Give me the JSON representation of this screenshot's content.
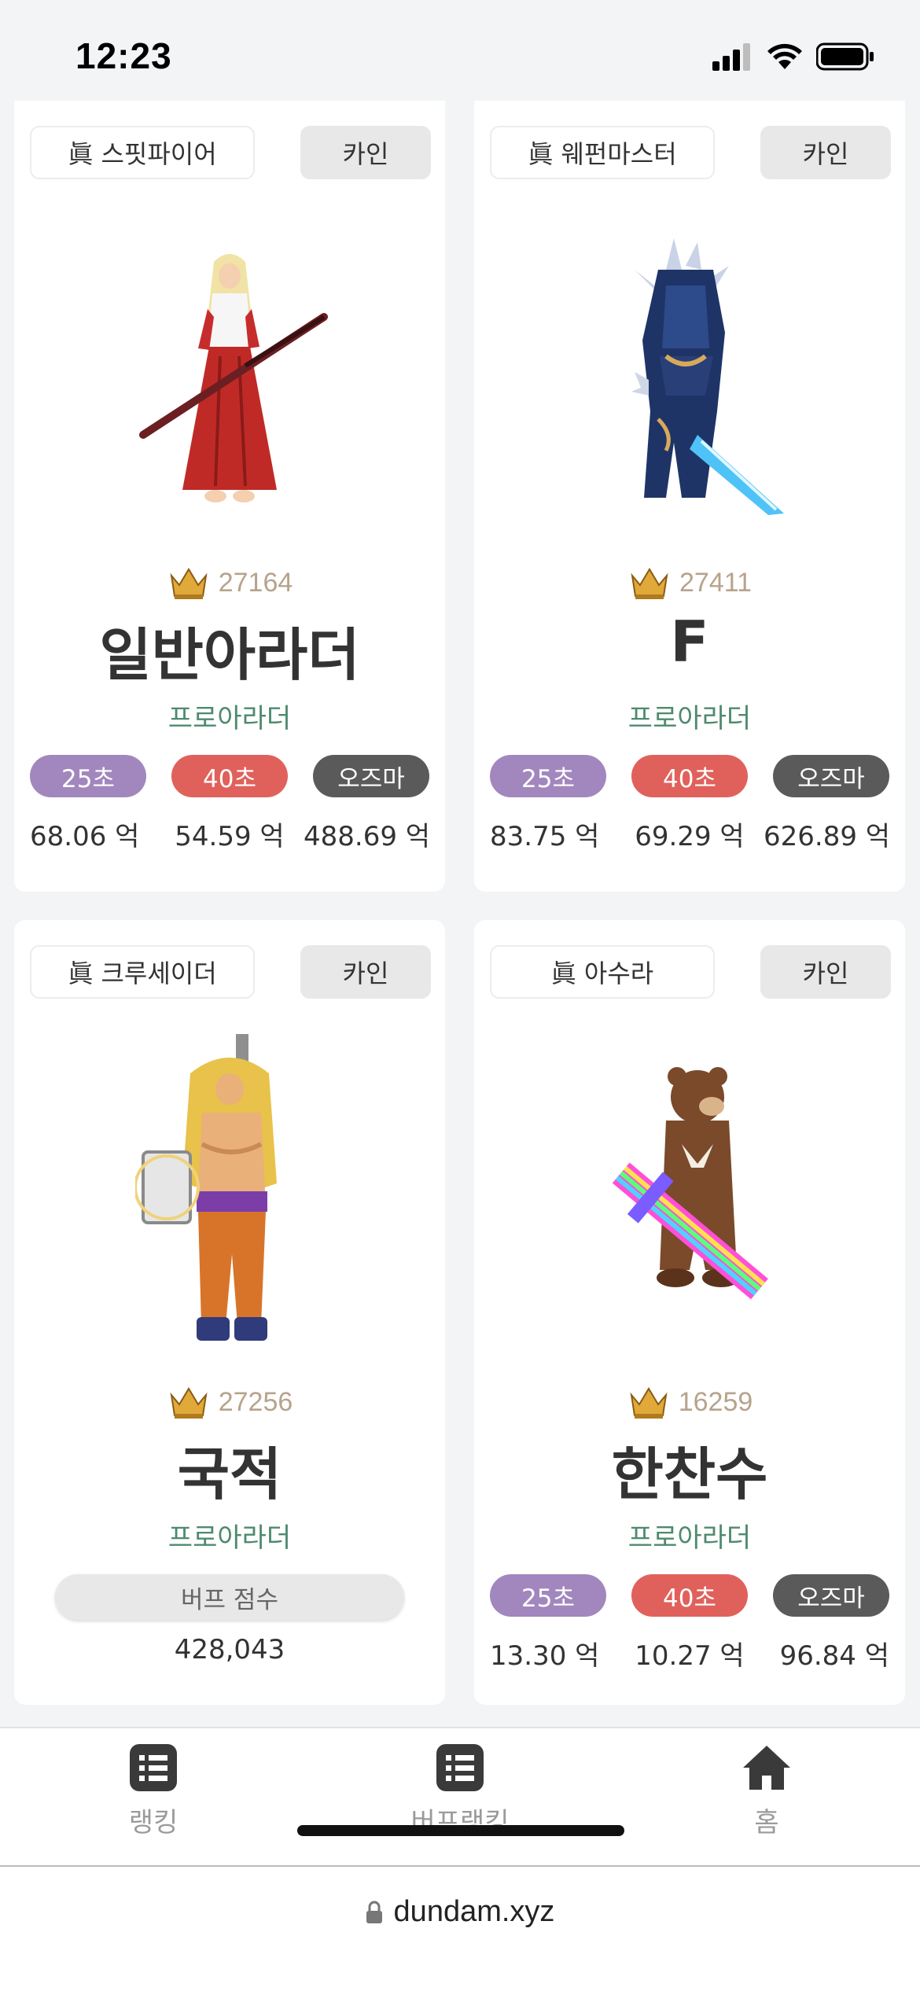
{
  "status_bar": {
    "time": "12:23"
  },
  "cards": [
    {
      "job": "眞 스핏파이어",
      "server": "카인",
      "rank": "27164",
      "name": "일반아라더",
      "adventure": "프로아라더",
      "type": "dealer",
      "labels": [
        "25초",
        "40초",
        "오즈마"
      ],
      "values": [
        "68.06 억",
        "54.59 억",
        "488.69 억"
      ],
      "character_icon": "shrine-maiden-sword-character"
    },
    {
      "job": "眞 웨펀마스터",
      "server": "카인",
      "rank": "27411",
      "name": "F",
      "adventure": "프로아라더",
      "type": "dealer",
      "labels": [
        "25초",
        "40초",
        "오즈마"
      ],
      "values": [
        "83.75 억",
        "69.29 억",
        "626.89 억"
      ],
      "character_icon": "armored-weapon-master-character"
    },
    {
      "job": "眞 크루세이더",
      "server": "카인",
      "rank": "27256",
      "name": "국적",
      "adventure": "프로아라더",
      "type": "buffer",
      "buff_label": "버프 점수",
      "buff_value": "428,043",
      "character_icon": "crusader-character"
    },
    {
      "job": "眞 아수라",
      "server": "카인",
      "rank": "16259",
      "name": "한찬수",
      "adventure": "프로아라더",
      "type": "dealer",
      "labels": [
        "25초",
        "40초",
        "오즈마"
      ],
      "values": [
        "13.30 억",
        "10.27 억",
        "96.84 억"
      ],
      "character_icon": "bear-rainbow-sword-character"
    }
  ],
  "bottom_nav": [
    {
      "label": "랭킹",
      "icon": "list-icon"
    },
    {
      "label": "버프랭킹",
      "icon": "list-icon"
    },
    {
      "label": "홈",
      "icon": "home-icon"
    }
  ],
  "url_bar": {
    "url": "dundam.xyz",
    "icon": "lock-icon"
  },
  "colors": {
    "pill_25": "#a287be",
    "pill_40": "#e0615c",
    "pill_ozma": "#5a5a5a",
    "rank_text": "#b7a38c",
    "adventure_text": "#4e8a6e"
  }
}
